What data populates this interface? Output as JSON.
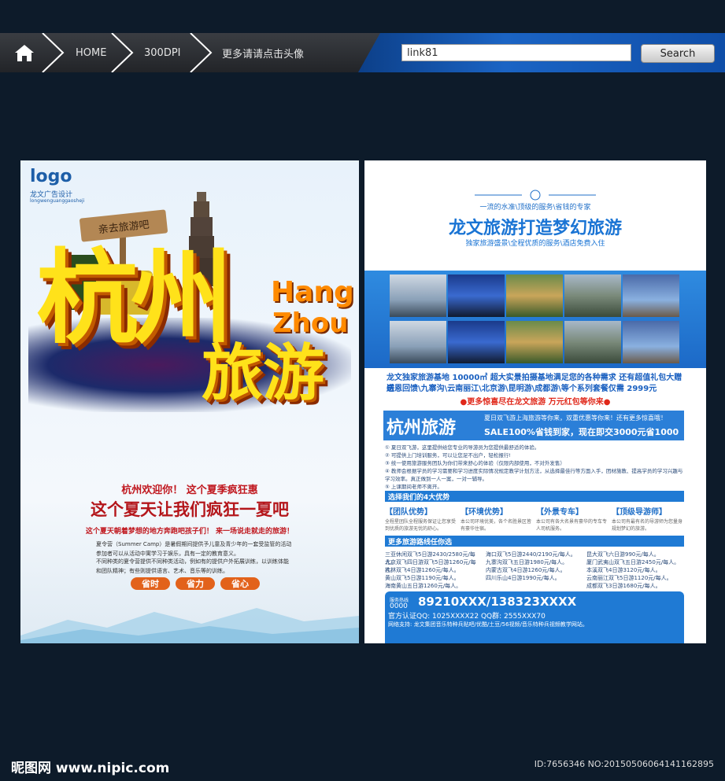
{
  "nav": {
    "home": "HOME",
    "dpi": "300DPI",
    "more": "更多请请点击头像",
    "search_value": "link81",
    "search_button": "Search"
  },
  "left_poster": {
    "logo": "logo",
    "logo_sub": "龙文广告设计",
    "logo_sub2": "longwenguanggaosheji",
    "sign": "亲去旅游吧",
    "big_hz": "杭州",
    "big_ly": "旅游",
    "en_hang": "Hang",
    "en_zhou": "Zhou",
    "line1": "杭州欢迎你！ 这个夏季疯狂惠",
    "line2": "这个夏天让我们疯狂一夏吧",
    "line3": "这个夏天朝着梦想的地方奔跑吧孩子们！ 来一场说走就走的旅游！",
    "para1": "夏令营（Summer Camp）是暑假期间提供予儿童及青少年的一套受监管的活动参加者可以从活动中寓学习于娱乐，具有一定的教育意义。",
    "para2": "不同种类的夏令营提供不同种类活动，例如有的提供户外拓展训练，以训练体能和团队精神；有些则提供语言、艺术、音乐等的训练。",
    "pills": [
      "省时",
      "省力",
      "省心"
    ]
  },
  "right_poster": {
    "slogan": "一流的水准\\顶级的服务\\省钱的专家",
    "title": "龙文旅游打造梦幻旅游",
    "subtitle": "独家旅游盛景\\全程优质的服务\\酒店免费入住",
    "desc1": "龙文独家旅游基地 10000㎡ 超大实景拍摄基地满足您的各种需求 还有超值礼包大赠送",
    "desc2": "感恩回馈\\九寨沟\\云南丽江\\北京游\\昆明游\\成都游\\等个系列套餐仅需 2999元",
    "red_line": "●更多惊喜尽在龙文旅游 万元红包等你来●",
    "hz_title": "杭州旅游",
    "hz_line1": "夏日双飞游上海旅游等你来，双重优惠等你来！还有更多惊喜哦！",
    "hz_line2": "SALE100%省钱到家，现在即交3000元省1000元",
    "notes": [
      "① 夏日双飞游，这里提供给您专业的导游员为您提供最舒适的体验。",
      "② 可提供上门培训服务，可以让您足不出户，轻松报行!",
      "③ 统一使用旅游服务团队为你们带来舒心的体验（仅限内部使用，不对外发售）",
      "④ 教师会根据学员的学习需要和学习进度实际情况规定教学计划方法，从选择最佳行等方面入手，团材施教、提高学员的学习兴趣与学习效率。真正做到一人一案，一对一辅导。",
      "⑤ 上课期间老师不离开。"
    ],
    "adv_title": "选择我们的4大优势",
    "advantages": [
      {
        "h": "【团队优势】",
        "b": "全程星团队全程服务保证让您享受到优质的旅游无忧的舒心。"
      },
      {
        "h": "【环境优势】",
        "b": "本公司环境优美，各个名胜景区皆有豪华住宿。"
      },
      {
        "h": "【外景专车】",
        "b": "本公司有各大名景有豪华的专车专人司机服务。"
      },
      {
        "h": "【顶级导游师】",
        "b": "本公司有最有名的导游师为您量身规划梦幻的旅游。"
      }
    ],
    "routes_title": "更多旅游路线任你选",
    "routes": [
      "三亚休闲双飞5日游2430/2580元/每人。",
      "北京双飞四日游双飞5日游1260元/每人。",
      "桂林双飞4日游1260元/每人。",
      "黄山双飞5日游1190元/每人。",
      "海南黄山五日游1260元/每人。",
      "海口双飞5日游2440/2190元/每人。",
      "九寨沟双飞五日游1980元/每人。",
      "内蒙古双飞4日游1260元/每人。",
      "四川乐山4日游1990元/每人。",
      "昆大双飞六日游990元/每人。",
      "厦门武夷山双飞五日游2450元/每人。",
      "本溪双飞4日游3120元/每人。",
      "云南丽江双飞5日游1120元/每人。",
      "成都双飞3日游1680元/每人。"
    ],
    "hotline_label": "服务热线",
    "hotline_pre": "0000",
    "hotline": "89210XXX/138323XXXX",
    "qq": "官方认证QQ: 1025XXXX22    QQ群: 2555XXX70",
    "support": "网络支持: 龙文集团音乐特种兵贴吧/优酷/土豆/56视频/音乐特种兵视频教学网站。"
  },
  "footer": {
    "brand": "昵图网 www.nipic.com",
    "id": "ID:7656346 NO:20150506064141162895"
  }
}
